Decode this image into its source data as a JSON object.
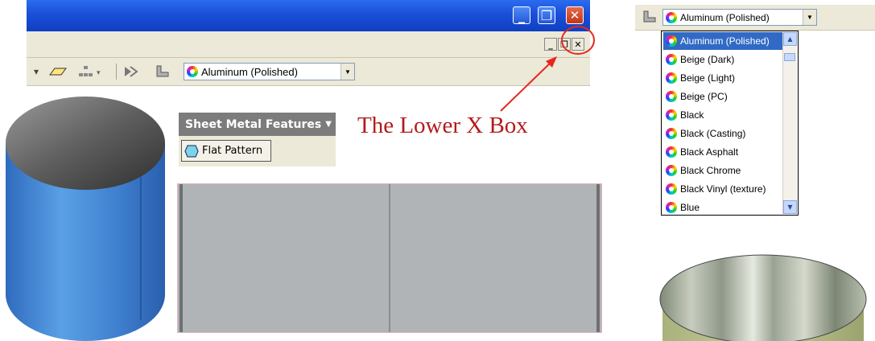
{
  "left_window": {
    "material_combo": {
      "value": "Aluminum (Polished)"
    },
    "controls": {
      "minimize_label": "_",
      "restore_label": "❐",
      "close_label": "✕"
    },
    "mdi_controls": {
      "minimize_label": "_",
      "restore_label": "❐",
      "close_label": "✕"
    }
  },
  "sheet_metal_panel": {
    "header": "Sheet Metal Features",
    "flat_pattern_label": "Flat Pattern"
  },
  "annotation": {
    "text": "The Lower X Box",
    "color": "#b31b1b"
  },
  "right_dropdown": {
    "combo_value": "Aluminum (Polished)",
    "items": [
      {
        "label": "Aluminum (Polished)",
        "selected": true
      },
      {
        "label": "Beige (Dark)"
      },
      {
        "label": "Beige (Light)"
      },
      {
        "label": "Beige (PC)"
      },
      {
        "label": "Black"
      },
      {
        "label": "Black (Casting)"
      },
      {
        "label": "Black Asphalt"
      },
      {
        "label": "Black Chrome"
      },
      {
        "label": "Black Vinyl (texture)"
      },
      {
        "label": "Blue"
      }
    ]
  },
  "colors": {
    "title_bar_blue": "#1a4fd8",
    "toolbar_bg": "#ece9d8",
    "selection_blue": "#316ac5",
    "cylinder_blue": "#4a8ad2",
    "flat_pattern_gray": "#b1b4b7"
  }
}
